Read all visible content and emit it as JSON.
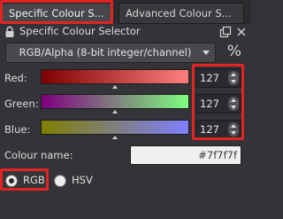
{
  "tabs": [
    {
      "label": "Specific Colour S...",
      "active": true
    },
    {
      "label": "Advanced Colour S...",
      "active": false
    }
  ],
  "panel": {
    "title": "Specific Colour Selector"
  },
  "model_select": {
    "value": "RGB/Alpha (8-bit integer/channel)"
  },
  "percent_toggle": {
    "label": "%"
  },
  "channels": [
    {
      "label": "Red:",
      "value": "127"
    },
    {
      "label": "Green:",
      "value": "127"
    },
    {
      "label": "Blue:",
      "value": "127"
    }
  ],
  "colour_name": {
    "label": "Colour name:",
    "value": "#7f7f7f"
  },
  "radios": [
    {
      "label": "RGB",
      "checked": true
    },
    {
      "label": "HSV",
      "checked": false
    }
  ],
  "colors": {
    "accent_highlight": "#e12424",
    "background": "#333437",
    "red_gradient": [
      "#7f0000",
      "#ff7f7f"
    ],
    "green_gradient": [
      "#7f007f",
      "#7fff7f"
    ],
    "blue_gradient": [
      "#7f7f00",
      "#7f7fff"
    ]
  }
}
